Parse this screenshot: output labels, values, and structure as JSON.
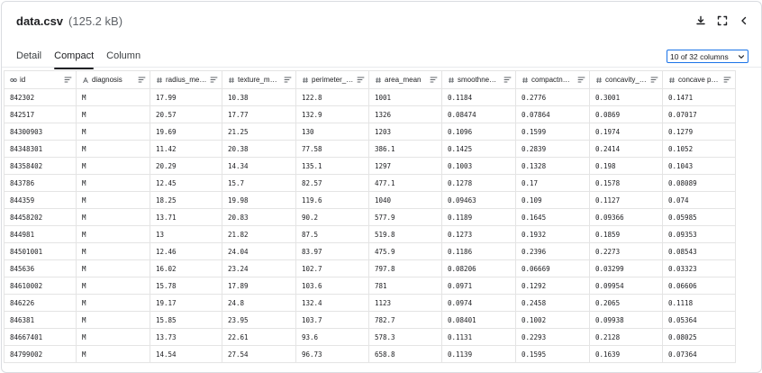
{
  "file": {
    "name": "data.csv",
    "size": "(125.2 kB)"
  },
  "tabs": [
    {
      "label": "Detail",
      "active": false
    },
    {
      "label": "Compact",
      "active": true
    },
    {
      "label": "Column",
      "active": false
    }
  ],
  "column_selector": {
    "label": "10 of 32 columns"
  },
  "icons": {
    "download": "download-icon",
    "fullscreen": "fullscreen-icon",
    "collapse": "chevron-left-icon"
  },
  "columns": [
    {
      "label": "id",
      "icon": "key-icon"
    },
    {
      "label": "diagnosis",
      "icon": "string-type-icon"
    },
    {
      "label": "radius_mean",
      "icon": "number-type-icon"
    },
    {
      "label": "texture_m…",
      "icon": "number-type-icon"
    },
    {
      "label": "perimeter_…",
      "icon": "number-type-icon"
    },
    {
      "label": "area_mean",
      "icon": "number-type-icon"
    },
    {
      "label": "smoothne…",
      "icon": "number-type-icon"
    },
    {
      "label": "compactn…",
      "icon": "number-type-icon"
    },
    {
      "label": "concavity_…",
      "icon": "number-type-icon"
    },
    {
      "label": "concave p…",
      "icon": "number-type-icon"
    }
  ],
  "rows": [
    [
      "842302",
      "M",
      "17.99",
      "10.38",
      "122.8",
      "1001",
      "0.1184",
      "0.2776",
      "0.3001",
      "0.1471"
    ],
    [
      "842517",
      "M",
      "20.57",
      "17.77",
      "132.9",
      "1326",
      "0.08474",
      "0.07864",
      "0.0869",
      "0.07017"
    ],
    [
      "84300903",
      "M",
      "19.69",
      "21.25",
      "130",
      "1203",
      "0.1096",
      "0.1599",
      "0.1974",
      "0.1279"
    ],
    [
      "84348301",
      "M",
      "11.42",
      "20.38",
      "77.58",
      "386.1",
      "0.1425",
      "0.2839",
      "0.2414",
      "0.1052"
    ],
    [
      "84358402",
      "M",
      "20.29",
      "14.34",
      "135.1",
      "1297",
      "0.1003",
      "0.1328",
      "0.198",
      "0.1043"
    ],
    [
      "843786",
      "M",
      "12.45",
      "15.7",
      "82.57",
      "477.1",
      "0.1278",
      "0.17",
      "0.1578",
      "0.08089"
    ],
    [
      "844359",
      "M",
      "18.25",
      "19.98",
      "119.6",
      "1040",
      "0.09463",
      "0.109",
      "0.1127",
      "0.074"
    ],
    [
      "84458202",
      "M",
      "13.71",
      "20.83",
      "90.2",
      "577.9",
      "0.1189",
      "0.1645",
      "0.09366",
      "0.05985"
    ],
    [
      "844981",
      "M",
      "13",
      "21.82",
      "87.5",
      "519.8",
      "0.1273",
      "0.1932",
      "0.1859",
      "0.09353"
    ],
    [
      "84501001",
      "M",
      "12.46",
      "24.04",
      "83.97",
      "475.9",
      "0.1186",
      "0.2396",
      "0.2273",
      "0.08543"
    ],
    [
      "845636",
      "M",
      "16.02",
      "23.24",
      "102.7",
      "797.8",
      "0.08206",
      "0.06669",
      "0.03299",
      "0.03323"
    ],
    [
      "84610002",
      "M",
      "15.78",
      "17.89",
      "103.6",
      "781",
      "0.0971",
      "0.1292",
      "0.09954",
      "0.06606"
    ],
    [
      "846226",
      "M",
      "19.17",
      "24.8",
      "132.4",
      "1123",
      "0.0974",
      "0.2458",
      "0.2065",
      "0.1118"
    ],
    [
      "846381",
      "M",
      "15.85",
      "23.95",
      "103.7",
      "782.7",
      "0.08401",
      "0.1002",
      "0.09938",
      "0.05364"
    ],
    [
      "84667401",
      "M",
      "13.73",
      "22.61",
      "93.6",
      "578.3",
      "0.1131",
      "0.2293",
      "0.2128",
      "0.08025"
    ],
    [
      "84799002",
      "M",
      "14.54",
      "27.54",
      "96.73",
      "658.8",
      "0.1139",
      "0.1595",
      "0.1639",
      "0.07364"
    ]
  ]
}
